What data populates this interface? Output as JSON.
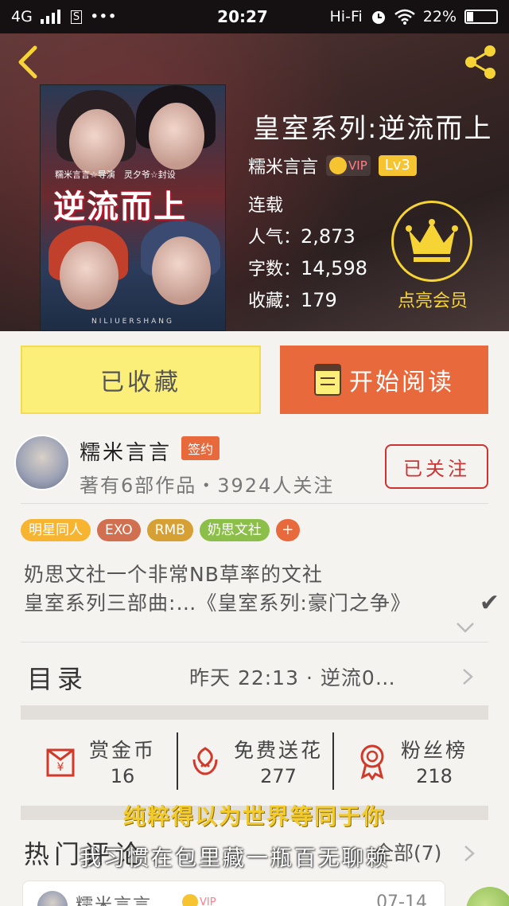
{
  "status_bar": {
    "network": "4G",
    "sim_icon": "S",
    "more": "•••",
    "time": "20:27",
    "audio": "Hi-Fi",
    "battery": "22%",
    "battery_level": 0.22
  },
  "header": {
    "book_title": "皇室系列:逆流而上",
    "author_name": "糯米言言",
    "vip_label": "VIP",
    "level": "Lv3",
    "status": "连载",
    "popularity_label": "人气：",
    "popularity": "2,873",
    "words_label": "字数：",
    "words": "14,598",
    "favorites_label": "收藏：",
    "favorites": "179",
    "member_label": "点亮会员",
    "cover": {
      "title": "逆流而上",
      "subtitle": "糯米言言☆导演　灵夕爷☆封设",
      "footer": "NILIUERSHANG"
    }
  },
  "actions": {
    "favorite_label": "已收藏",
    "read_label": "开始阅读"
  },
  "author_info": {
    "name": "糯米言言",
    "signed_tag": "签约",
    "meta": "著有6部作品・3924人关注",
    "follow_label": "已关注"
  },
  "tags": [
    {
      "label": "明星同人",
      "color": "#f6b431"
    },
    {
      "label": "EXO",
      "color": "#d07050"
    },
    {
      "label": "RMB",
      "color": "#d6a034"
    },
    {
      "label": "奶思文社",
      "color": "#8cbf4a"
    }
  ],
  "tag_add": "+",
  "description": {
    "line1": "奶思文社一个非常NB草率的文社",
    "line2": "皇室系列三部曲:…《皇室系列:豪门之争》",
    "check": "✔"
  },
  "catalog": {
    "title": "目录",
    "update": "昨天 22:13 · 逆流0…"
  },
  "rewards": [
    {
      "label": "赏金币",
      "count": "16",
      "icon": "red-envelope-icon"
    },
    {
      "label": "免费送花",
      "count": "277",
      "icon": "flower-icon"
    },
    {
      "label": "粉丝榜",
      "count": "218",
      "icon": "medal-icon"
    }
  ],
  "lyrics": {
    "line1": "纯粹得以为世界等同于你",
    "line2": "我习惯在包里藏一瓶百无聊赖"
  },
  "comments": {
    "title": "热门评论",
    "count": "全部(7)",
    "first": {
      "name": "糯米言言",
      "vip": "VIP",
      "date": "07-14"
    }
  },
  "colors": {
    "accent_orange": "#e8693c",
    "favorite_yellow": "#fbef7a",
    "gold": "#f6d435",
    "follow_red": "#cc3333"
  }
}
